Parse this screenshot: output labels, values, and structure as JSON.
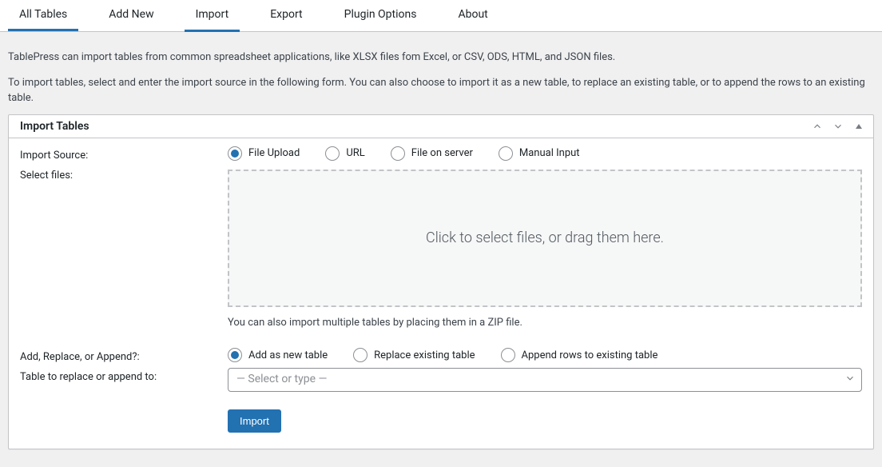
{
  "tabs": {
    "all_tables": "All Tables",
    "add_new": "Add New",
    "import": "Import",
    "export": "Export",
    "plugin_options": "Plugin Options",
    "about": "About"
  },
  "intro": {
    "line1": "TablePress can import tables from common spreadsheet applications, like XLSX files fom Excel, or CSV, ODS, HTML, and JSON files.",
    "line2": "To import tables, select and enter the import source in the following form. You can also choose to import it as a new table, to replace an existing table, or to append the rows to an existing table."
  },
  "postbox": {
    "title": "Import Tables"
  },
  "labels": {
    "import_source": "Import Source:",
    "select_files": "Select files:",
    "add_replace_append": "Add, Replace, or Append?:",
    "table_to_replace": "Table to replace or append to:"
  },
  "source_options": {
    "file_upload": "File Upload",
    "url": "URL",
    "file_on_server": "File on server",
    "manual_input": "Manual Input"
  },
  "dropzone": {
    "text": "Click to select files, or drag them here."
  },
  "zip_hint": "You can also import multiple tables by placing them in a ZIP file.",
  "type_options": {
    "add": "Add as new table",
    "replace": "Replace existing table",
    "append": "Append rows to existing table"
  },
  "table_select": {
    "placeholder": "— Select or type —"
  },
  "buttons": {
    "import": "Import"
  }
}
